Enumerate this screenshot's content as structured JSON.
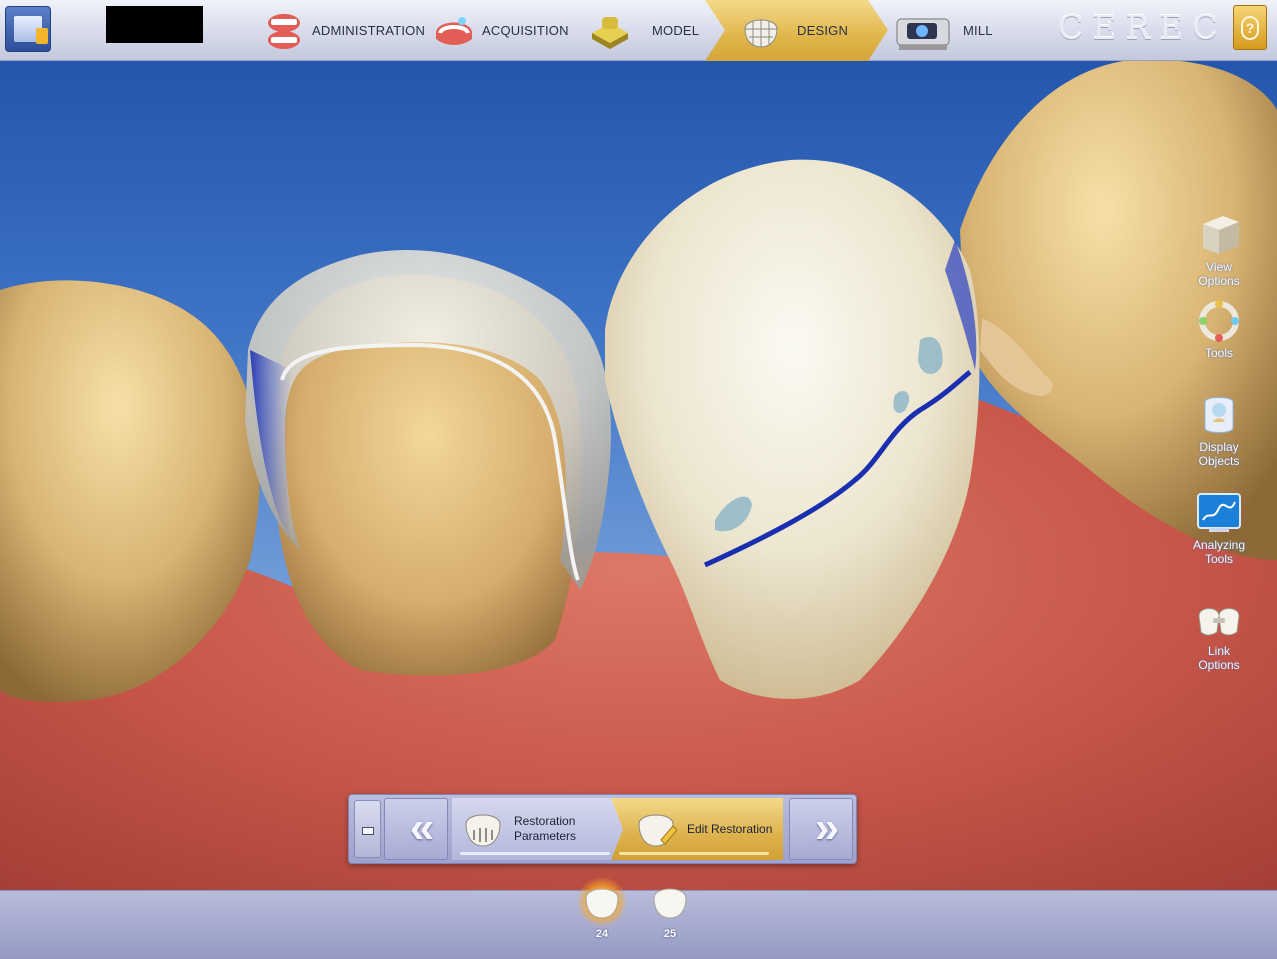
{
  "app": {
    "brand": "CEREC",
    "menu_icon": "app-menu-icon",
    "help_icon": "help-icon"
  },
  "phases": [
    {
      "label": "ADMINISTRATION",
      "icon": "dentures-icon"
    },
    {
      "label": "ACQUISITION",
      "icon": "scan-arch-icon"
    },
    {
      "label": "MODEL",
      "icon": "model-block-icon"
    },
    {
      "label": "DESIGN",
      "icon": "crown-mesh-icon",
      "active": true
    },
    {
      "label": "MILL",
      "icon": "milling-unit-icon"
    }
  ],
  "side_tools": [
    {
      "label": "View Options",
      "icon": "cube-icon"
    },
    {
      "label": "Tools",
      "icon": "tool-ring-icon"
    },
    {
      "label": "Display Objects",
      "icon": "display-objects-icon"
    },
    {
      "label": "Analyzing Tools",
      "icon": "analysis-chart-icon"
    },
    {
      "label": "Link Options",
      "icon": "linked-crowns-icon"
    }
  ],
  "steps": {
    "prev_label": "«",
    "next_label": "»",
    "items": [
      {
        "label": "Restoration Parameters",
        "icon": "crown-parameters-icon"
      },
      {
        "label": "Edit Restoration",
        "icon": "crown-edit-icon",
        "active": true
      }
    ]
  },
  "teeth": [
    {
      "number": "24",
      "active": true
    },
    {
      "number": "25",
      "active": false
    }
  ],
  "colors": {
    "accent": "#e0b64a",
    "viewport_top": "#1e4fa8",
    "gingiva": "#c9584a",
    "margin_line": "#1a2fb0"
  }
}
